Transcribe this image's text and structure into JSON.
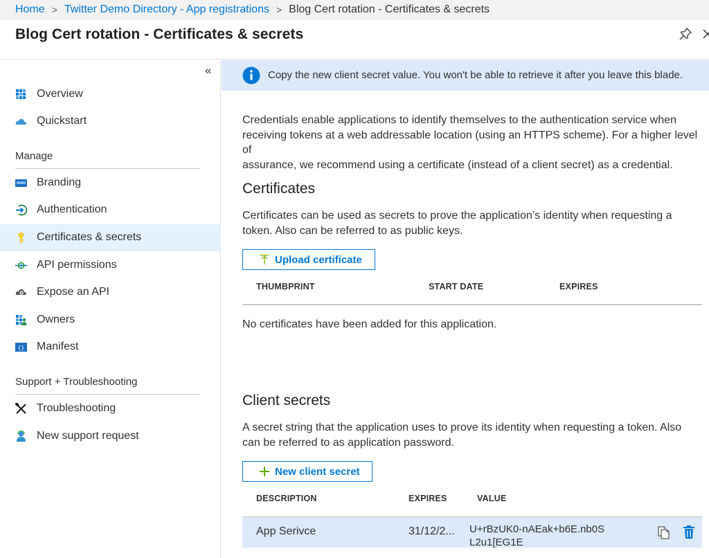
{
  "breadcrumb": {
    "home": "Home",
    "directory": "Twitter Demo Directory - App registrations",
    "current": "Blog Cert rotation - Certificates & secrets",
    "separator": ">"
  },
  "header": {
    "title": "Blog Cert rotation - Certificates & secrets"
  },
  "sidebar": {
    "collapse_glyph": "«",
    "items_top": [
      {
        "label": "Overview",
        "icon": "grid-icon"
      },
      {
        "label": "Quickstart",
        "icon": "cloud-icon"
      }
    ],
    "manage_label": "Manage",
    "manage_items": [
      {
        "label": "Branding",
        "icon": "branding-icon"
      },
      {
        "label": "Authentication",
        "icon": "authentication-icon"
      },
      {
        "label": "Certificates & secrets",
        "icon": "key-icon",
        "selected": true
      },
      {
        "label": "API permissions",
        "icon": "api-permissions-icon"
      },
      {
        "label": "Expose an API",
        "icon": "cloud-gear-icon"
      },
      {
        "label": "Owners",
        "icon": "owners-icon"
      },
      {
        "label": "Manifest",
        "icon": "manifest-icon"
      }
    ],
    "support_label": "Support + Troubleshooting",
    "support_items": [
      {
        "label": "Troubleshooting",
        "icon": "wrench-icon"
      },
      {
        "label": "New support request",
        "icon": "support-person-icon"
      }
    ]
  },
  "banner": {
    "text": "Copy the new client secret value. You won't be able to retrieve it after you leave this blade."
  },
  "intro": {
    "line1": "Credentials enable applications to identify themselves to the authentication service when",
    "line2": "receiving tokens at a web addressable location (using an HTTPS scheme). For a higher level of",
    "line3": "assurance, we recommend using a certificate (instead of a client secret) as a credential."
  },
  "certificates": {
    "title": "Certificates",
    "desc_line1": "Certificates can be used as secrets to prove the application’s identity when requesting a",
    "desc_line2": "token. Also can be referred to as public keys.",
    "upload_label": "Upload certificate",
    "columns": [
      "THUMBPRINT",
      "START DATE",
      "EXPIRES"
    ],
    "empty_message": "No certificates have been added for this application."
  },
  "client_secrets": {
    "title": "Client secrets",
    "desc_line1": "A secret string that the application uses to prove its identity when requesting a token. Also",
    "desc_line2": "can be referred to as application password.",
    "new_label": "New client secret",
    "columns": [
      "DESCRIPTION",
      "EXPIRES",
      "VALUE"
    ],
    "rows": [
      {
        "description": "App Serivce",
        "expires": "31/12/2...",
        "value": "U+rBzUK0-nAEak+b6E.nb0SL2u1[EG1E"
      }
    ]
  },
  "colors": {
    "accent": "#0078d4",
    "banner_bg": "#dbe9f9",
    "selected_bg": "#e5f1fb"
  }
}
